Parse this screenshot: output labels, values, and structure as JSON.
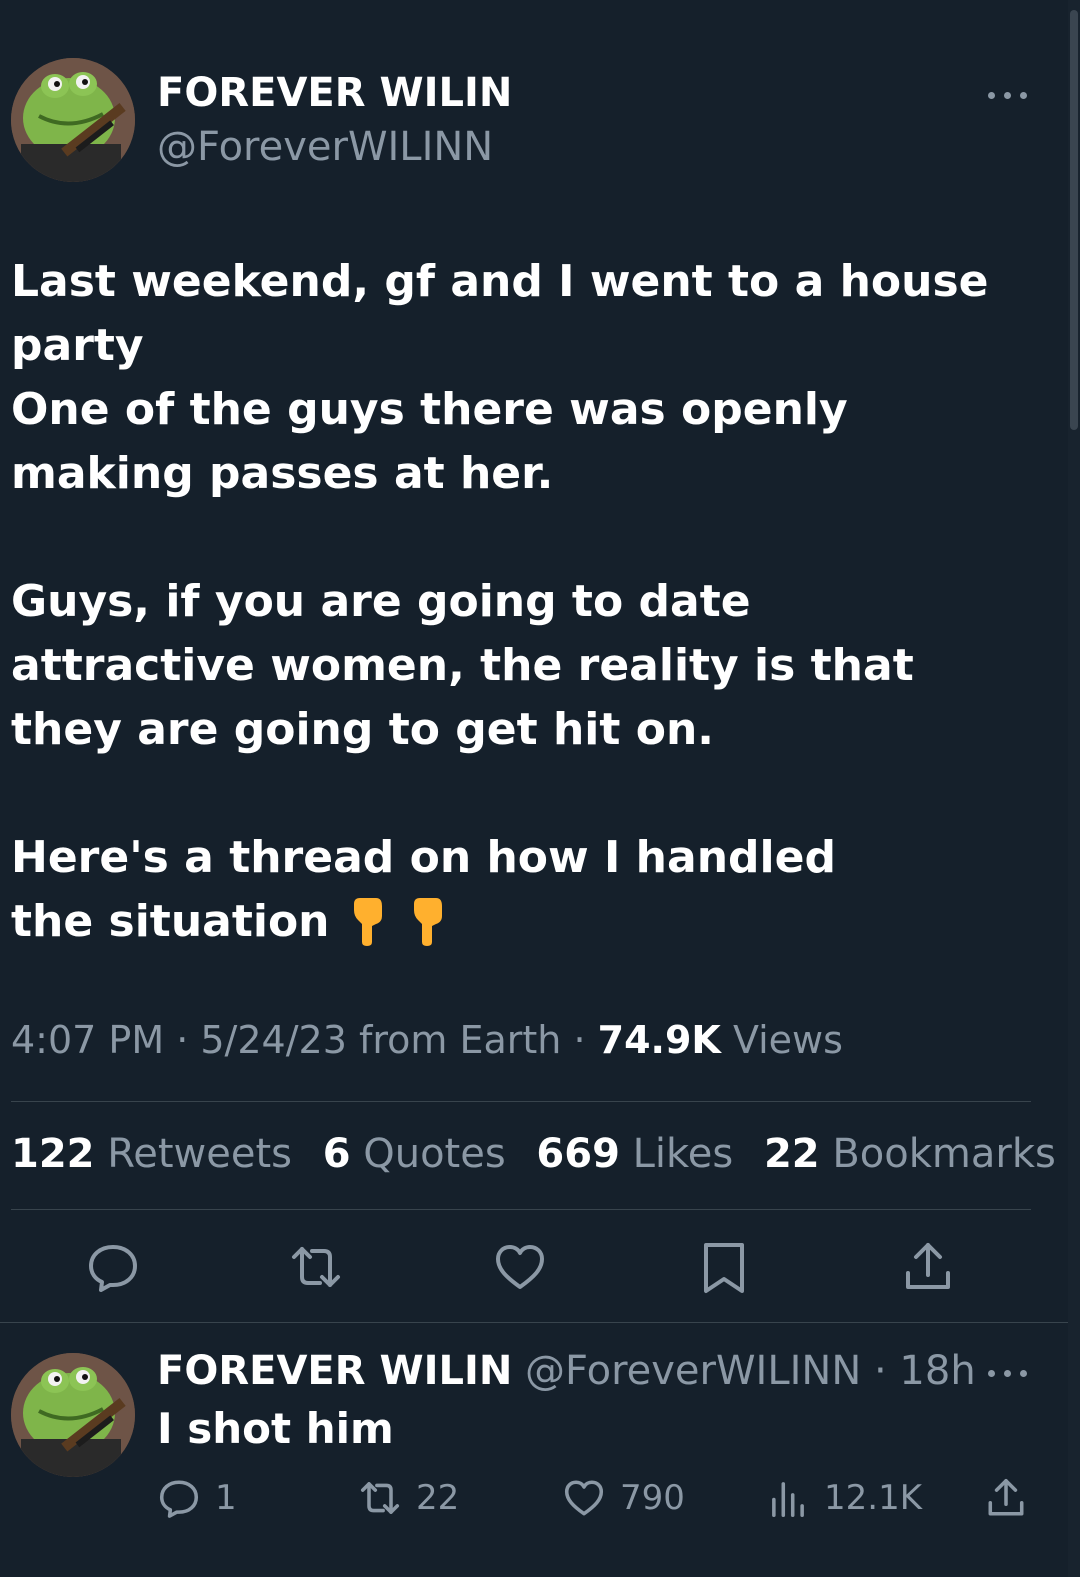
{
  "tweet": {
    "display_name": "FOREVER WILIN",
    "handle": "@ForeverWILINN",
    "paragraphs": [
      "Last weekend, gf and I went to a house party",
      "One of the guys there was openly making passes at her.",
      "Guys, if you are going to date attractive women, the reality is that they are going to get hit on.",
      "Here's a thread on how I handled the situation"
    ],
    "emoji": "👇👇",
    "time": "4:07 PM",
    "date": "5/24/23",
    "source": "from Earth",
    "views_count": "74.9K",
    "views_label": "Views",
    "stats": {
      "retweets_count": "122",
      "retweets_label": "Retweets",
      "quotes_count": "6",
      "quotes_label": "Quotes",
      "likes_count": "669",
      "likes_label": "Likes",
      "bookmarks_count": "22",
      "bookmarks_label": "Bookmarks"
    }
  },
  "reply": {
    "display_name": "FOREVER WILIN",
    "handle": "@ForeverWILINN",
    "age": "18h",
    "text": "I shot him",
    "reply_count": "1",
    "retweet_count": "22",
    "like_count": "790",
    "view_count": "12.1K"
  },
  "icons": {
    "more": "more-icon",
    "reply": "reply-icon",
    "retweet": "retweet-icon",
    "like": "heart-icon",
    "bookmark": "bookmark-icon",
    "share": "share-icon",
    "views": "views-icon"
  },
  "colors": {
    "background": "#15202b",
    "text": "#ffffff",
    "secondary": "#8b98a5",
    "divider": "#38444d"
  }
}
